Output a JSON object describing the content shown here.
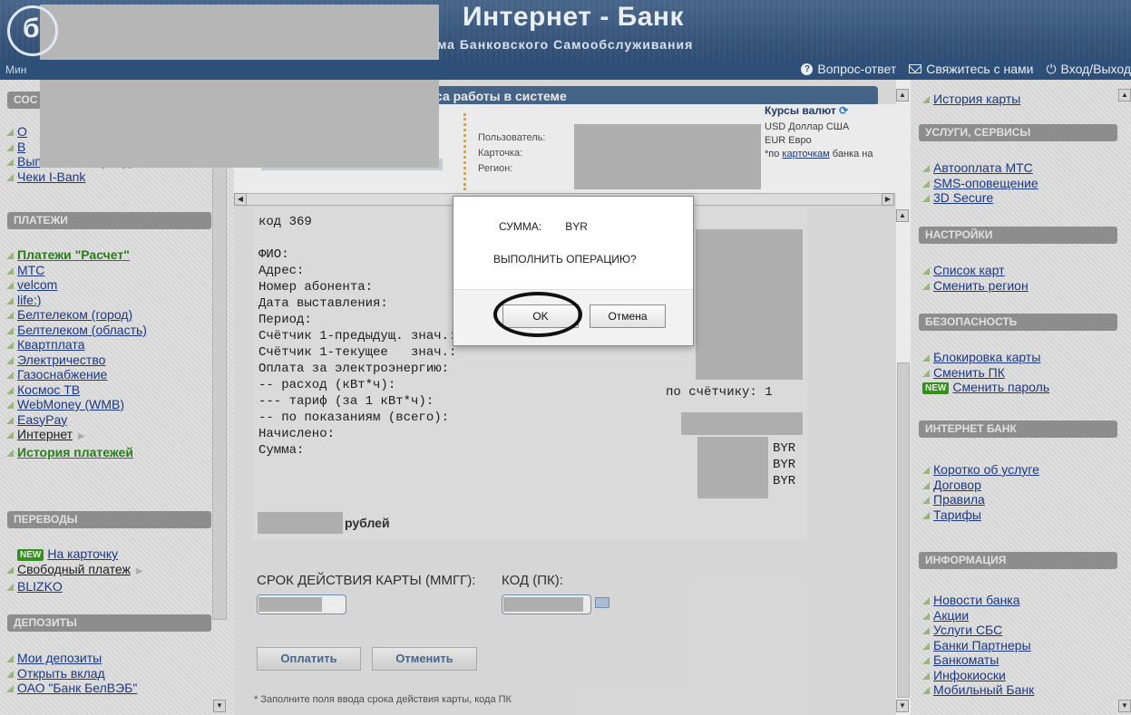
{
  "header": {
    "title": "Интернет - Банк",
    "subtitle": "ма Банковского Самообслуживания",
    "strip_left": "Мин",
    "links": [
      {
        "label": "Вопрос-ответ",
        "icon": "question-icon"
      },
      {
        "label": "Свяжитесь с нами",
        "icon": "mail-icon"
      },
      {
        "label": "Вход/Выход",
        "icon": "power-icon"
      }
    ]
  },
  "left_sidebar": {
    "top_title": "СОС",
    "top_items": [
      "О",
      "В",
      "Выписка за период",
      "Чеки I-Bank"
    ],
    "payments_title": "ПЛАТЕЖИ",
    "payments": [
      "Платежи \"Расчет\"",
      "МТС",
      "velcom",
      "life:)",
      "Белтелеком (город)",
      "Белтелеком (область)",
      "Квартплата",
      "Электричество",
      "Газоснабжение",
      "Космос ТВ",
      "WebMoney (WMB)",
      "EasyPay",
      "Интернет",
      "История платежей"
    ],
    "transfers_title": "ПЕРЕВОДЫ",
    "transfers": [
      "На карточку",
      "Свободный платеж",
      "BLIZKO"
    ],
    "new_badge": "NEW",
    "deposits_title": "ДЕПОЗИТЫ",
    "deposits": [
      "Мои депозиты",
      "Открыть вклад",
      "ОАО \"Банк БелВЭБ\""
    ]
  },
  "right_sidebar": {
    "top_items": [
      "История карты"
    ],
    "services_title": "УСЛУГИ, СЕРВИСЫ",
    "services": [
      "Автооплата МТС",
      "SMS-оповещение",
      "3D Secure"
    ],
    "settings_title": "НАСТРОЙКИ",
    "settings": [
      "Список карт",
      "Сменить регион"
    ],
    "security_title": "БЕЗОПАСНОСТЬ",
    "security": [
      "Блокировка карты",
      "Сменить ПК",
      "Сменить пароль"
    ],
    "new_badge": "NEW",
    "ibank_title": "ИНТЕРНЕТ БАНК",
    "ibank": [
      "Коротко об услуге",
      "Договор",
      "Правила",
      "Тарифы"
    ],
    "info_title": "ИНФОРМАЦИЯ",
    "info": [
      "Новости банка",
      "Акции",
      "Услуги СБС",
      "Банки Партнеры",
      "Банкоматы",
      "Инфокиоски",
      "Мобильный Банк"
    ]
  },
  "main": {
    "tab_title": "са работы в системе",
    "info_labels": [
      "Пользователь:",
      "Карточка:",
      "Регион:"
    ],
    "rates_title": "Курсы валют",
    "rates": [
      "USD  Доллар США",
      "EUR  Евро"
    ],
    "rates_note_pre": "*по ",
    "rates_note_link": "карточкам",
    "rates_note_post": " банка на",
    "receipt_text": "код 369\n\nФИО:\nАдрес:                    По\nНомер абонента:\nДата выставления:\nПериод:\nСчётчик 1-предыдущ. знач.:\nСчётчик 1-текущее   знач.:\nОплата за электроэнергию:\n-- расход (кВт*ч):\n--- тариф (за 1 кВт*ч):\n-- по показаниям (всего):\nНачислено:\nСумма:",
    "receipt_right": "по счётчику: 1",
    "currency_1": "BYR",
    "currency_2": "BYR",
    "currency_3": "BYR",
    "total_words": "рублей",
    "expiry_label": "СРОК ДЕЙСТВИЯ КАРТЫ (ММГГ):",
    "code_label": "КОД (ПК):",
    "pay_button": "Оплатить",
    "cancel_button": "Отменить",
    "footnote": "* Заполните поля ввода срока действия карты, кода ПК"
  },
  "modal": {
    "sum_label": "СУММА:",
    "sum_currency": "BYR",
    "question": "ВЫПОЛНИТЬ ОПЕРАЦИЮ?",
    "ok_label": "OK",
    "cancel_label": "Отмена"
  }
}
